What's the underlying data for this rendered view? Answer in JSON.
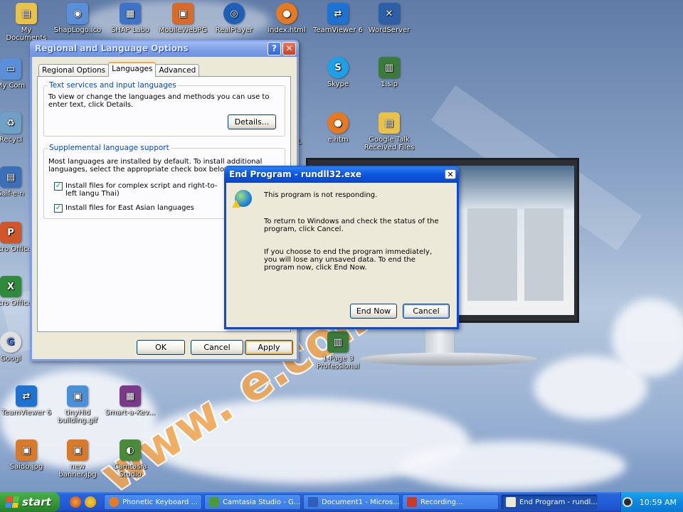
{
  "desktop": {
    "top_icons": [
      {
        "label": "My Documents",
        "color": "#e8c24a"
      },
      {
        "label": "ShapLogo.ico",
        "color": "#5a8fd8"
      },
      {
        "label": "SHAP Labo",
        "color": "#3e73c8"
      },
      {
        "label": "MobileWebPG",
        "color": "#d76b2b"
      },
      {
        "label": "RealPlayer",
        "color": "#1f5fb8"
      },
      {
        "label": "index.html",
        "color": "#e57a23"
      },
      {
        "label": "TeamViewer 6",
        "color": "#1e73d2"
      },
      {
        "label": "WordServer",
        "color": "#2c5fa8"
      }
    ],
    "left_icons": [
      {
        "label": "My Com",
        "color": "#5a8fd8"
      },
      {
        "label": "Recycl",
        "color": "#6ea0c8"
      },
      {
        "label": "Saif-e-n",
        "color": "#3b6fb8"
      },
      {
        "label": "Micro Office",
        "color": "#d1552a"
      },
      {
        "label": "Micro Office",
        "color": "#2f8a3b"
      },
      {
        "label": "Googl",
        "color": "#e0e0e0"
      }
    ],
    "mid_icons": [
      {
        "label": "Skype",
        "color": "#1ea0e6"
      },
      {
        "label": "1.sip",
        "color": "#3a7a3a"
      },
      {
        "label": "e.htm",
        "color": "#e57a23"
      },
      {
        "label": "Google Talk Received Files",
        "color": "#e8c24a"
      },
      {
        "label": "ALL",
        "color": "#6a6a6a"
      },
      {
        "label": "1-Page 3 Professional",
        "color": "#3a7a3a"
      }
    ],
    "bottom_icons": [
      {
        "label": "TeamViewer 6",
        "color": "#1e73d2"
      },
      {
        "label": "tinyHid building.gif",
        "color": "#4a90d8"
      },
      {
        "label": "Smart-a-Kev...",
        "color": "#7a3a8a"
      },
      {
        "label": "Saidb.jpg",
        "color": "#d87a2a"
      },
      {
        "label": "new banner.jpg",
        "color": "#d87a2a"
      },
      {
        "label": "Camtasia Studio",
        "color": "#4a8a3a"
      }
    ],
    "watermark": "www.                e.com"
  },
  "regional_window": {
    "title": "Regional and Language Options",
    "help_label": "?",
    "close_label": "✕",
    "tabs": [
      "Regional Options",
      "Languages",
      "Advanced"
    ],
    "selected_tab": "Languages",
    "group1": {
      "legend": "Text services and input languages",
      "text": "To view or change the languages and methods you can use to enter text, click Details.",
      "details_button": "Details..."
    },
    "group2": {
      "legend": "Supplemental language support",
      "text": "Most languages are installed by default. To install additional languages, select the appropriate check box below.",
      "checkbox1": "Install files for complex script and right-to-left langu Thai)",
      "checkbox1_checked": true,
      "checkbox2": "Install files for East Asian languages",
      "checkbox2_checked": true
    },
    "ok_button": "OK",
    "cancel_button": "Cancel",
    "apply_button": "Apply"
  },
  "end_program_dialog": {
    "title": "End Program - rundll32.exe",
    "close_label": "✕",
    "line1": "This program is not responding.",
    "line2": "To return to Windows and check the status of the program, click Cancel.",
    "line3": "If you choose to end the program immediately, you will lose any unsaved data. To end the program now, click End Now.",
    "end_now_button": "End Now",
    "cancel_button": "Cancel"
  },
  "taskbar": {
    "start_label": "start",
    "tasks": [
      {
        "label": "Phonetic Keyboard ...",
        "color": "#e57a23"
      },
      {
        "label": "Camtasia Studio - G...",
        "color": "#4a9a3a"
      },
      {
        "label": "Document1 - Micros...",
        "color": "#2f5fb8"
      },
      {
        "label": "Recording...",
        "color": "#c93a2a"
      },
      {
        "label": "End Program - rundl...",
        "color": "#ece9d8"
      }
    ],
    "clock": "10:59 AM"
  }
}
